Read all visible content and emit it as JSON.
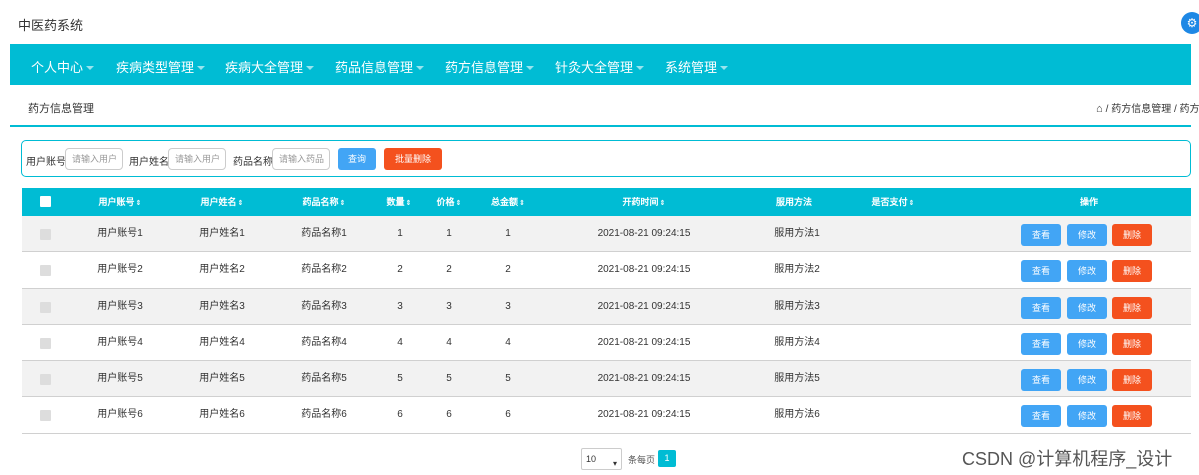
{
  "app": {
    "title": "中医药系统",
    "user_icon": "user-icon"
  },
  "nav": {
    "items": [
      {
        "label": "个人中心"
      },
      {
        "label": "疾病类型管理"
      },
      {
        "label": "疾病大全管理"
      },
      {
        "label": "药品信息管理"
      },
      {
        "label": "药方信息管理"
      },
      {
        "label": "针灸大全管理"
      },
      {
        "label": "系统管理"
      }
    ]
  },
  "page": {
    "title": "药方信息管理",
    "breadcrumb": "/ 药方信息管理 / 药方"
  },
  "search": {
    "account_label": "用户账号",
    "account_placeholder": "请输入用户",
    "name_label": "用户姓名",
    "name_placeholder": "请输入用户",
    "drug_label": "药品名称",
    "drug_placeholder": "请输入药品",
    "query_button": "查询",
    "batch_delete_button": "批量删除"
  },
  "table": {
    "columns": [
      "用户账号",
      "用户姓名",
      "药品名称",
      "数量",
      "价格",
      "总金额",
      "开药时间",
      "服用方法",
      "是否支付",
      "操作"
    ],
    "sort_symbol": "⇕",
    "rows": [
      {
        "account": "用户账号1",
        "name": "用户姓名1",
        "drug": "药品名称1",
        "qty": "1",
        "price": "1",
        "total": "1",
        "time": "2021-08-21 09:24:15",
        "method": "服用方法1"
      },
      {
        "account": "用户账号2",
        "name": "用户姓名2",
        "drug": "药品名称2",
        "qty": "2",
        "price": "2",
        "total": "2",
        "time": "2021-08-21 09:24:15",
        "method": "服用方法2"
      },
      {
        "account": "用户账号3",
        "name": "用户姓名3",
        "drug": "药品名称3",
        "qty": "3",
        "price": "3",
        "total": "3",
        "time": "2021-08-21 09:24:15",
        "method": "服用方法3"
      },
      {
        "account": "用户账号4",
        "name": "用户姓名4",
        "drug": "药品名称4",
        "qty": "4",
        "price": "4",
        "total": "4",
        "time": "2021-08-21 09:24:15",
        "method": "服用方法4"
      },
      {
        "account": "用户账号5",
        "name": "用户姓名5",
        "drug": "药品名称5",
        "qty": "5",
        "price": "5",
        "total": "5",
        "time": "2021-08-21 09:24:15",
        "method": "服用方法5"
      },
      {
        "account": "用户账号6",
        "name": "用户姓名6",
        "drug": "药品名称6",
        "qty": "6",
        "price": "6",
        "total": "6",
        "time": "2021-08-21 09:24:15",
        "method": "服用方法6"
      }
    ],
    "actions": {
      "view": "查看",
      "edit": "修改",
      "delete": "删除"
    }
  },
  "pagination": {
    "page_size": "10",
    "per_page_label": "条每页",
    "current_page": "1"
  },
  "watermark": "CSDN @计算机程序_设计",
  "colors": {
    "accent": "#00bcd4",
    "primary_button": "#42a5f5",
    "danger_button": "#f4511e"
  }
}
